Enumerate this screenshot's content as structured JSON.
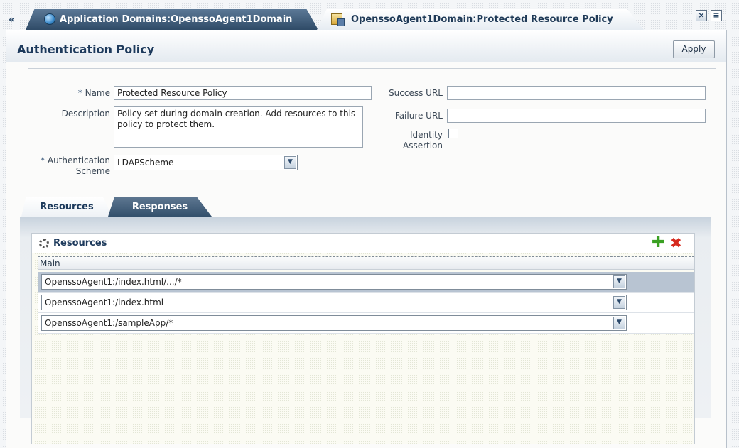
{
  "tabs": {
    "collapse_glyph": "«",
    "domain_tab": "Application Domains:OpenssoAgent1Domain",
    "policy_tab": "OpenssoAgent1Domain:Protected Resource Policy"
  },
  "header": {
    "title": "Authentication Policy",
    "apply_label": "Apply"
  },
  "form": {
    "name_label": "Name",
    "name_value": "Protected Resource Policy",
    "description_label": "Description",
    "description_value": "Policy set during domain creation. Add resources to this policy to protect them.",
    "auth_scheme_label_1": "Authentication",
    "auth_scheme_label_2": "Scheme",
    "auth_scheme_value": "LDAPScheme",
    "success_url_label": "Success URL",
    "success_url_value": "",
    "failure_url_label": "Failure URL",
    "failure_url_value": "",
    "identity_assertion_label_1": "Identity",
    "identity_assertion_label_2": "Assertion",
    "required_marker": "*"
  },
  "subtabs": {
    "resources": "Resources",
    "responses": "Responses"
  },
  "resources": {
    "title": "Resources",
    "column_header": "Main",
    "rows": [
      "OpenssoAgent1:/index.html/.../*",
      "OpenssoAgent1:/index.html",
      "OpenssoAgent1:/sampleApp/*"
    ]
  },
  "colors": {
    "accent": "#1d3a5c",
    "selected_row": "#b8c4d2",
    "add": "#3aa022",
    "delete": "#d62a1e"
  }
}
